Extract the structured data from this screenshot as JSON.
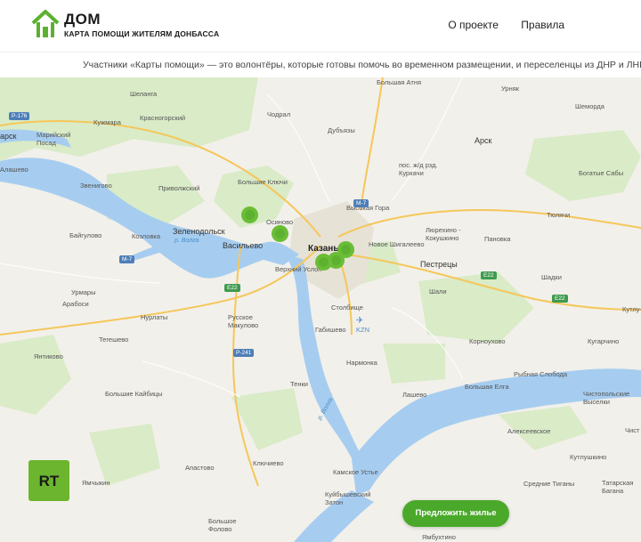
{
  "header": {
    "brand_title": "ДОМ",
    "brand_subtitle": "КАРТА ПОМОЩИ ЖИТЕЛЯМ ДОНБАССА",
    "nav": [
      "О проекте",
      "Правила"
    ]
  },
  "ticker": {
    "text": "Участники «Карты помощи» — это волонтёры, которые готовы помочь во временном размещении, и переселенцы из ДНР и ЛНР, с"
  },
  "map": {
    "labels": [
      "Большая Атня",
      "Урняк",
      "Шеланга",
      "Кужмара",
      "Красногорский",
      "Чодрал",
      "Шеморда",
      "арск",
      "Марийский Посад",
      "Дубъязы",
      "Арск",
      "пос. ж/д рзд. Куркачи",
      "Богатые Сабы",
      "Алашево",
      "Звениговo",
      "Приволжский",
      "Большие Ключи",
      "Высокая Гора",
      "Тюлячи",
      "Зеленодольск",
      "Осиново",
      "Новое Шигалеево",
      "Пановка",
      "Байгулово",
      "Козловка",
      "Васильево",
      "Казань",
      "Люрехино - Кокушкино",
      "Верхний Услон",
      "Пестрецы",
      "Шадки",
      "Урмары",
      "Арабоси",
      "Шали",
      "Кутлу-",
      "Нурлаты",
      "Столбище",
      "Русское Макулово",
      "Корноухово",
      "Кугарчино",
      "Тегешево",
      "Габишево",
      "Янтиково",
      "Нармонка",
      "Рыбная Слобода",
      "Тенки",
      "Большая Елга",
      "Большие Кайбицы",
      "Лашево",
      "Чистопольские Выселки",
      "Алексеевское",
      "Кутлушкино",
      "Апастово",
      "Ключиево",
      "Камское Устье",
      "Ямчыкин",
      "Средние Тиганы",
      "Татарская Багана",
      "Куйбышевский Затон",
      "Большое Фолово",
      "Ямбухтино",
      "Чист"
    ],
    "river_labels": [
      "р. Волга",
      "р. Волга"
    ],
    "road_shields": [
      "Р-176",
      "М-7",
      "М-7",
      "Е22",
      "Е22",
      "Р-241",
      "Е22"
    ],
    "airport_code": "KZN",
    "brand_badge": "RT",
    "cta_label": "Предложить жилье"
  }
}
